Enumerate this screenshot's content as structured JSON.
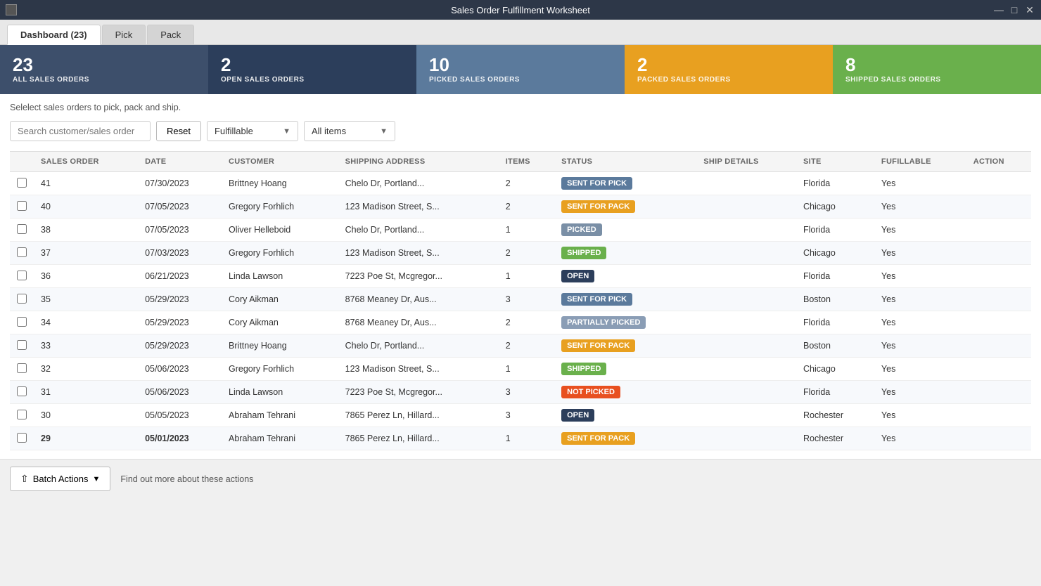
{
  "titleBar": {
    "title": "Sales Order Fulfillment Worksheet"
  },
  "tabs": [
    {
      "id": "dashboard",
      "label": "Dashboard (23)",
      "active": true
    },
    {
      "id": "pick",
      "label": "Pick",
      "active": false
    },
    {
      "id": "pack",
      "label": "Pack",
      "active": false
    }
  ],
  "stats": [
    {
      "id": "all",
      "number": "23",
      "label": "ALL SALES ORDERS",
      "colorClass": "dark-navy"
    },
    {
      "id": "open",
      "number": "2",
      "label": "OPEN SALES ORDERS",
      "colorClass": "dark-blue"
    },
    {
      "id": "picked",
      "number": "10",
      "label": "PICKED SALES ORDERS",
      "colorClass": "medium-blue"
    },
    {
      "id": "packed",
      "number": "2",
      "label": "PACKED SALES ORDERS",
      "colorClass": "orange"
    },
    {
      "id": "shipped",
      "number": "8",
      "label": "SHIPPED SALES ORDERS",
      "colorClass": "green"
    }
  ],
  "instruction": "Selelect sales orders to pick, pack and ship.",
  "filters": {
    "searchPlaceholder": "Search customer/sales order",
    "resetLabel": "Reset",
    "fulfillableLabel": "Fulfillable",
    "allItemsLabel": "All items"
  },
  "tableHeaders": [
    "SALES ORDER",
    "DATE",
    "CUSTOMER",
    "SHIPPING ADDRESS",
    "ITEMS",
    "STATUS",
    "SHIP DETAILS",
    "SITE",
    "FUFILLABLE",
    "ACTION"
  ],
  "rows": [
    {
      "id": 41,
      "date": "07/30/2023",
      "customer": "Brittney Hoang",
      "address": "Chelo Dr, Portland...",
      "items": 2,
      "status": "SENT FOR PICK",
      "statusClass": "badge-sent-pick",
      "shipDetails": "",
      "site": "Florida",
      "fulfillable": "Yes",
      "bold": false,
      "alt": false
    },
    {
      "id": 40,
      "date": "07/05/2023",
      "customer": "Gregory Forhlich",
      "address": "123 Madison Street, S...",
      "items": 2,
      "status": "SENT FOR PACK",
      "statusClass": "badge-sent-pack",
      "shipDetails": "",
      "site": "Chicago",
      "fulfillable": "Yes",
      "bold": false,
      "alt": true
    },
    {
      "id": 38,
      "date": "07/05/2023",
      "customer": "Oliver Helleboid",
      "address": "Chelo Dr, Portland...",
      "items": 1,
      "status": "PICKED",
      "statusClass": "badge-picked",
      "shipDetails": "",
      "site": "Florida",
      "fulfillable": "Yes",
      "bold": false,
      "alt": false
    },
    {
      "id": 37,
      "date": "07/03/2023",
      "customer": "Gregory Forhlich",
      "address": "123 Madison Street, S...",
      "items": 2,
      "status": "SHIPPED",
      "statusClass": "badge-shipped",
      "shipDetails": "",
      "site": "Chicago",
      "fulfillable": "Yes",
      "bold": false,
      "alt": true
    },
    {
      "id": 36,
      "date": "06/21/2023",
      "customer": "Linda Lawson",
      "address": "7223 Poe St, Mcgregor...",
      "items": 1,
      "status": "OPEN",
      "statusClass": "badge-open",
      "shipDetails": "",
      "site": "Florida",
      "fulfillable": "Yes",
      "bold": false,
      "alt": false
    },
    {
      "id": 35,
      "date": "05/29/2023",
      "customer": "Cory Aikman",
      "address": "8768 Meaney Dr, Aus...",
      "items": 3,
      "status": "SENT FOR PICK",
      "statusClass": "badge-sent-pick",
      "shipDetails": "",
      "site": "Boston",
      "fulfillable": "Yes",
      "bold": false,
      "alt": true
    },
    {
      "id": 34,
      "date": "05/29/2023",
      "customer": "Cory Aikman",
      "address": "8768 Meaney Dr, Aus...",
      "items": 2,
      "status": "PARTIALLY PICKED",
      "statusClass": "badge-partially-picked",
      "shipDetails": "",
      "site": "Florida",
      "fulfillable": "Yes",
      "bold": false,
      "alt": false
    },
    {
      "id": 33,
      "date": "05/29/2023",
      "customer": "Brittney Hoang",
      "address": "Chelo Dr, Portland...",
      "items": 2,
      "status": "SENT FOR PACK",
      "statusClass": "badge-sent-pack",
      "shipDetails": "",
      "site": "Boston",
      "fulfillable": "Yes",
      "bold": false,
      "alt": true
    },
    {
      "id": 32,
      "date": "05/06/2023",
      "customer": "Gregory Forhlich",
      "address": "123 Madison Street, S...",
      "items": 1,
      "status": "SHIPPED",
      "statusClass": "badge-shipped",
      "shipDetails": "",
      "site": "Chicago",
      "fulfillable": "Yes",
      "bold": false,
      "alt": false
    },
    {
      "id": 31,
      "date": "05/06/2023",
      "customer": "Linda Lawson",
      "address": "7223 Poe St, Mcgregor...",
      "items": 3,
      "status": "NOT PICKED",
      "statusClass": "badge-not-picked",
      "shipDetails": "",
      "site": "Florida",
      "fulfillable": "Yes",
      "bold": false,
      "alt": true
    },
    {
      "id": 30,
      "date": "05/05/2023",
      "customer": "Abraham Tehrani",
      "address": "7865 Perez Ln, Hillard...",
      "items": 3,
      "status": "OPEN",
      "statusClass": "badge-open",
      "shipDetails": "",
      "site": "Rochester",
      "fulfillable": "Yes",
      "bold": false,
      "alt": false
    },
    {
      "id": 29,
      "date": "05/01/2023",
      "customer": "Abraham Tehrani",
      "address": "7865 Perez Ln, Hillard...",
      "items": 1,
      "status": "SENT FOR PACK",
      "statusClass": "badge-sent-pack",
      "shipDetails": "",
      "site": "Rochester",
      "fulfillable": "Yes",
      "bold": true,
      "alt": true
    }
  ],
  "bottomBar": {
    "batchActionsLabel": "Batch Actions",
    "findOutMoreLabel": "Find out more about these actions"
  }
}
